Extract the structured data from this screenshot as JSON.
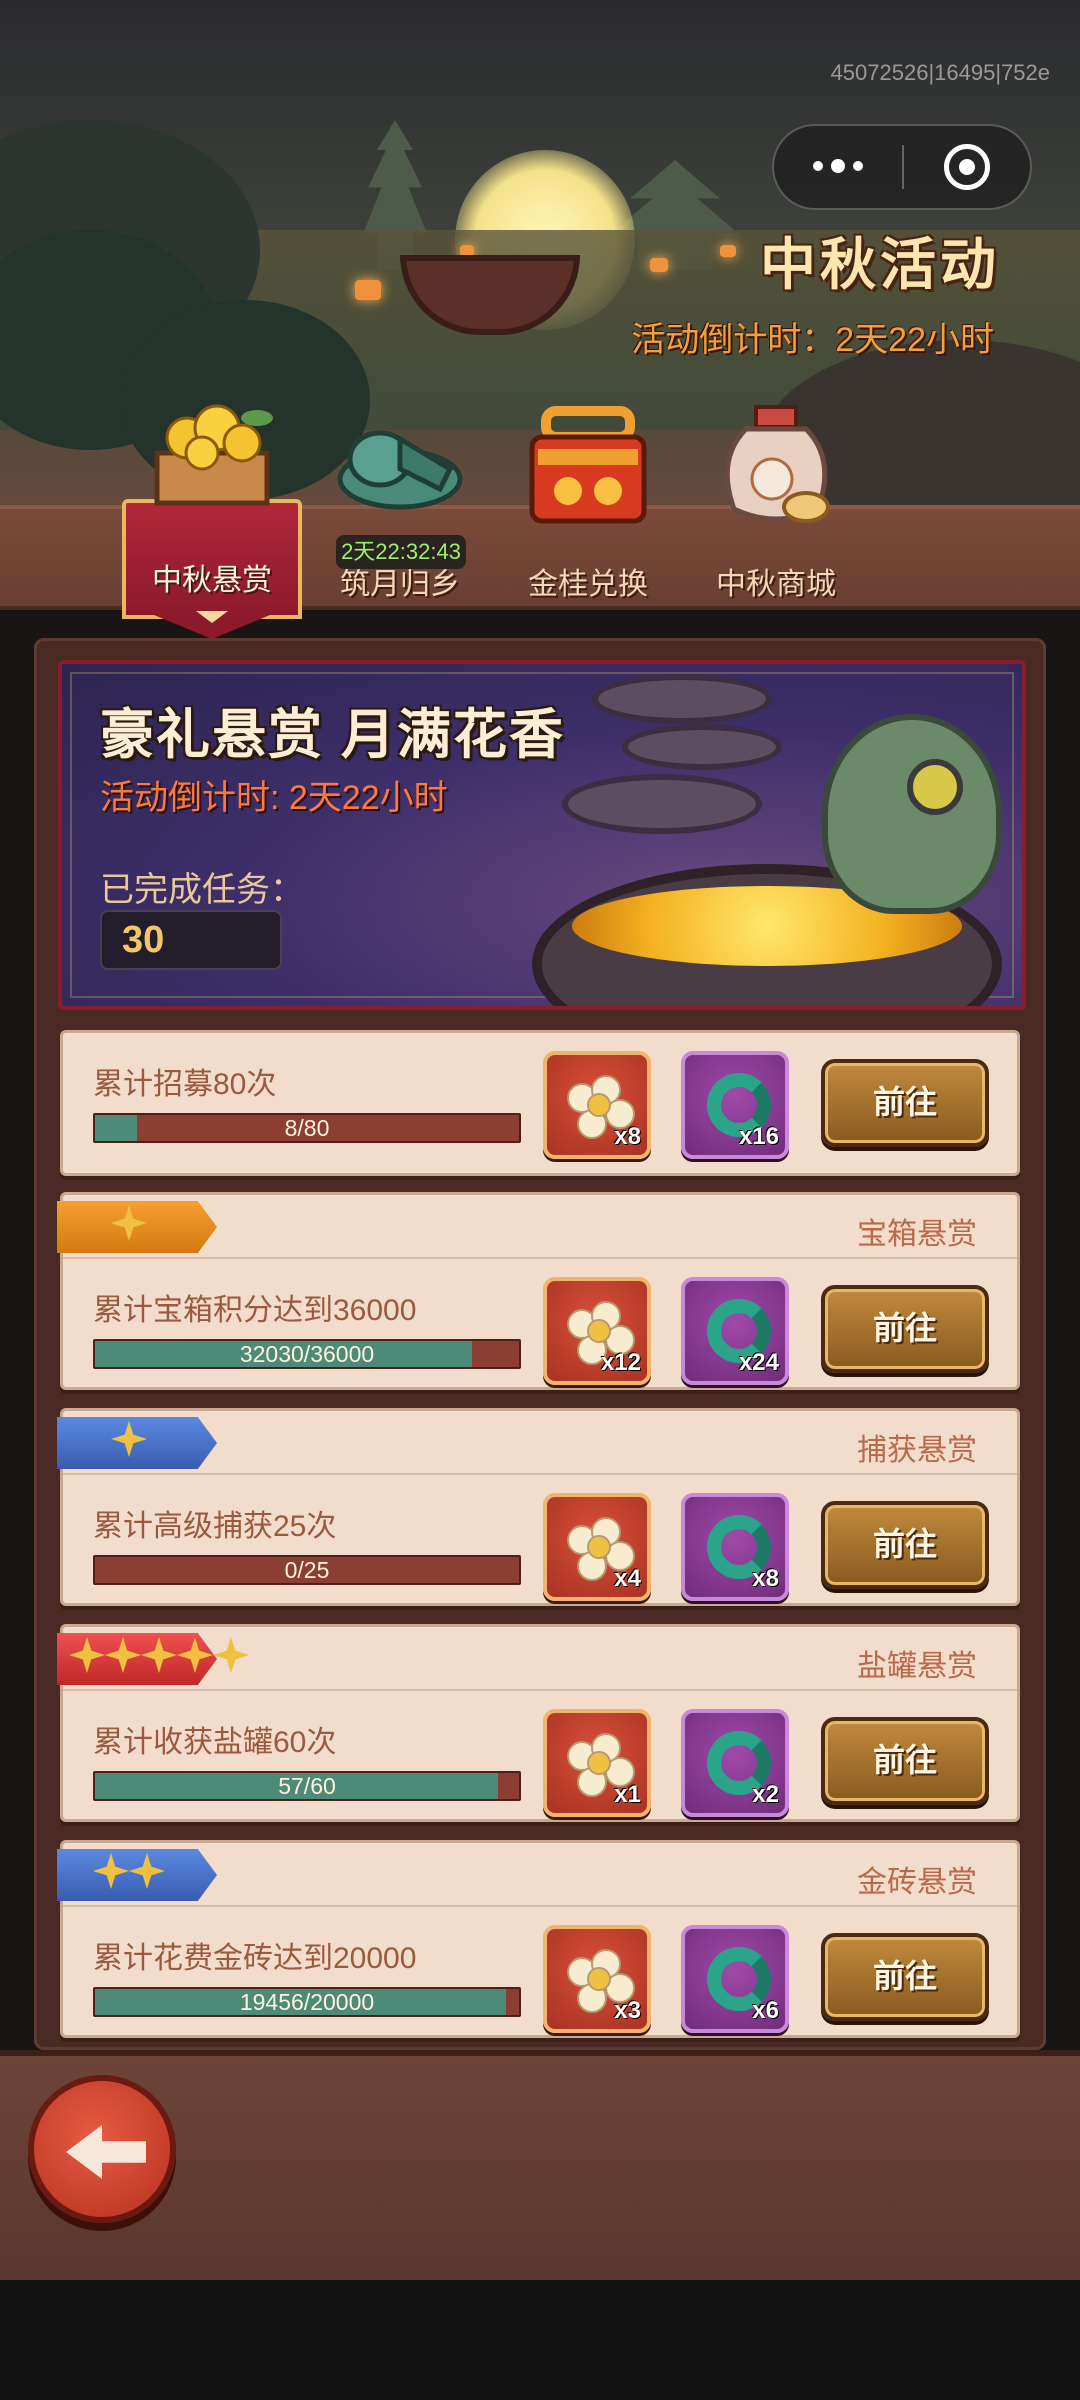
{
  "system": {
    "id_text": "45072526|16495|752e"
  },
  "event": {
    "title": "中秋活动",
    "countdown": "活动倒计时：2天22小时"
  },
  "tabs": [
    {
      "label": "中秋悬赏",
      "active": true,
      "icon": "osmanthus-crate-icon"
    },
    {
      "label": "筑月归乡",
      "active": false,
      "icon": "jade-icon",
      "timer": "2天22:32:43"
    },
    {
      "label": "金桂兑换",
      "active": false,
      "icon": "gift-box-icon"
    },
    {
      "label": "中秋商城",
      "active": false,
      "icon": "wine-jar-icon"
    }
  ],
  "banner": {
    "title": "豪礼悬赏 月满花香",
    "countdown": "活动倒计时: 2天22小时",
    "completed_label": "已完成任务：",
    "completed_count": "30"
  },
  "go_label": "前往",
  "tasks": [
    {
      "category": "",
      "desc": "累计招募80次",
      "progress_text": "8/80",
      "progress": 0.1,
      "rewards": [
        "x8",
        "x16"
      ],
      "ribbon": "blue"
    },
    {
      "category": "宝箱悬赏",
      "desc": "累计宝箱积分达到36000",
      "progress_text": "32030/36000",
      "progress": 0.89,
      "rewards": [
        "x12",
        "x24"
      ],
      "ribbon": "gold",
      "stars": 1
    },
    {
      "category": "捕获悬赏",
      "desc": "累计高级捕获25次",
      "progress_text": "0/25",
      "progress": 0.0,
      "rewards": [
        "x4",
        "x8"
      ],
      "ribbon": "blue",
      "stars": 1
    },
    {
      "category": "盐罐悬赏",
      "desc": "累计收获盐罐60次",
      "progress_text": "57/60",
      "progress": 0.95,
      "rewards": [
        "x1",
        "x2"
      ],
      "ribbon": "red",
      "stars": 5
    },
    {
      "category": "金砖悬赏",
      "desc": "累计花费金砖达到20000",
      "progress_text": "19456/20000",
      "progress": 0.97,
      "rewards": [
        "x3",
        "x6"
      ],
      "ribbon": "blue",
      "stars": 2
    }
  ],
  "colors": {
    "accent_red": "#8c1a2a",
    "progress_fill": "#4e8a78",
    "go_button": "#a87230"
  }
}
